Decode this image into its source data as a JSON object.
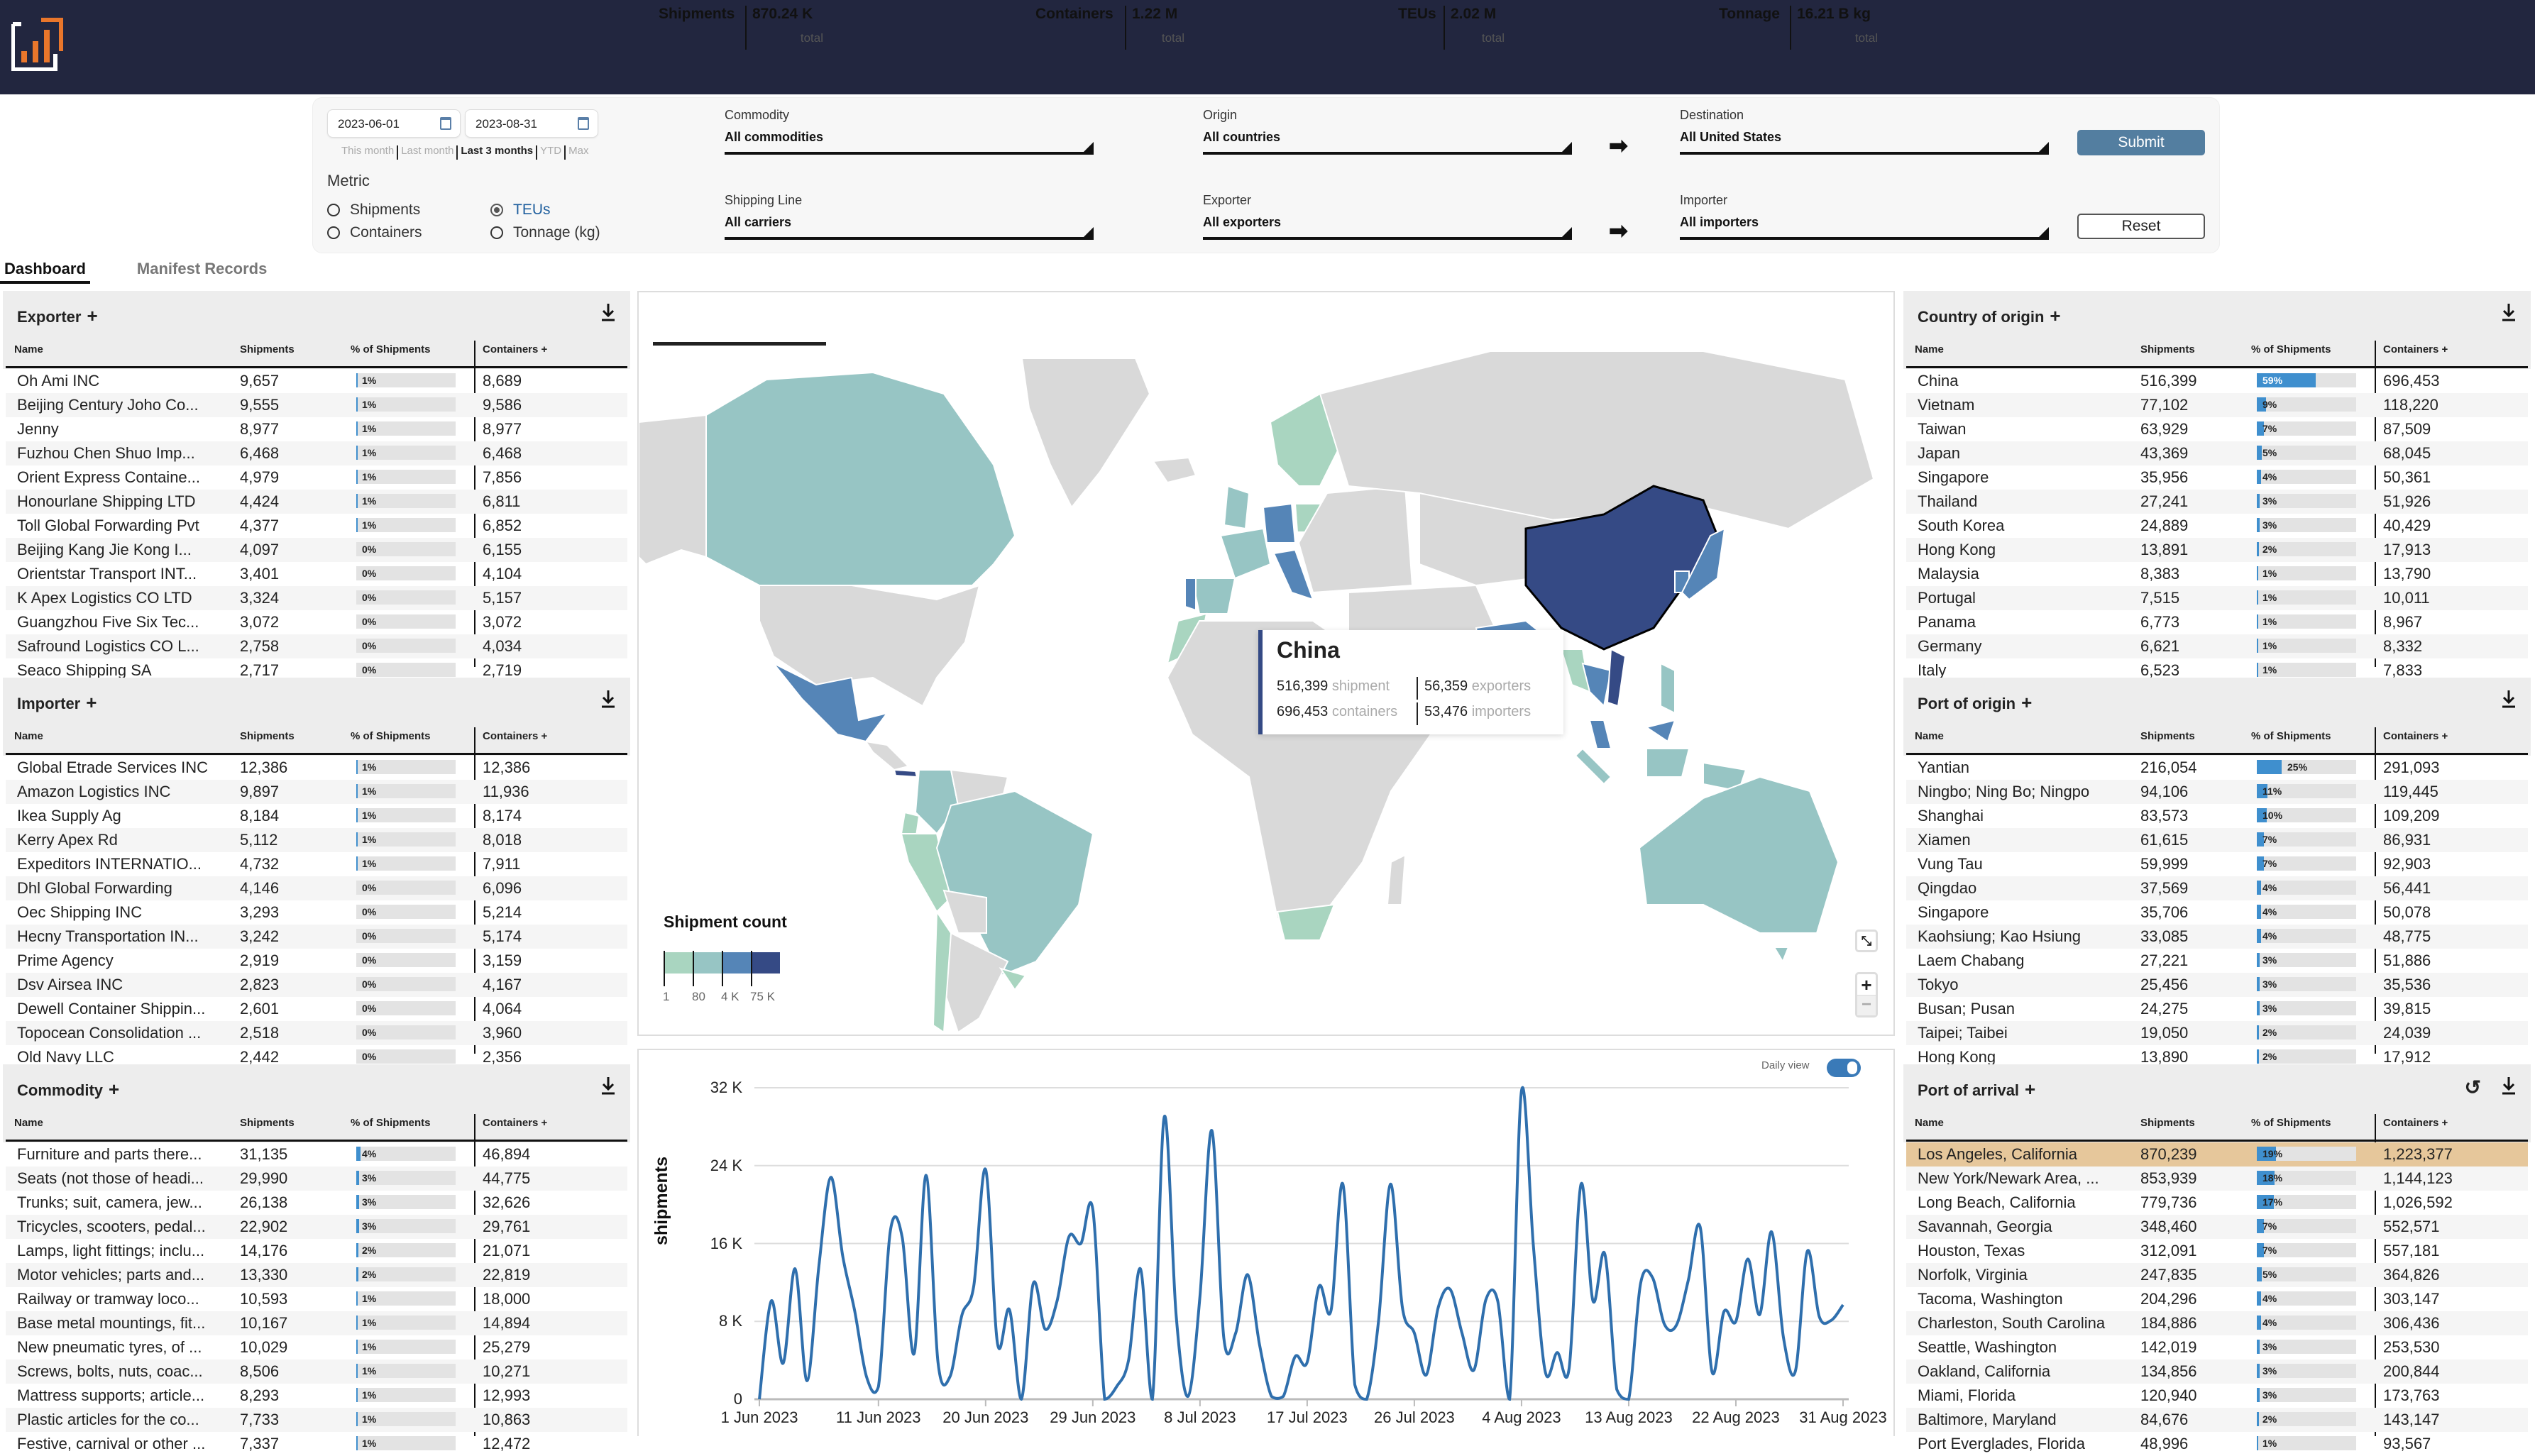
{
  "header": {
    "logo": "analytics-logo"
  },
  "filters": {
    "date_from": "2023-06-01",
    "date_to": "2023-08-31",
    "quick_ranges": [
      "This month",
      "Last month",
      "Last 3 months",
      "YTD",
      "Max"
    ],
    "quick_active": "Last 3 months",
    "metric_label": "Metric",
    "metrics": [
      {
        "label": "Shipments",
        "checked": false
      },
      {
        "label": "TEUs",
        "checked": true
      },
      {
        "label": "Containers",
        "checked": false
      },
      {
        "label": "Tonnage (kg)",
        "checked": false
      }
    ],
    "commodity": {
      "label": "Commodity",
      "value": "All commodities"
    },
    "origin": {
      "label": "Origin",
      "value": "All countries"
    },
    "destination": {
      "label": "Destination",
      "value": "All United States"
    },
    "shipping_line": {
      "label": "Shipping Line",
      "value": "All carriers"
    },
    "exporter": {
      "label": "Exporter",
      "value": "All exporters"
    },
    "importer": {
      "label": "Importer",
      "value": "All importers"
    },
    "arrow": "➡",
    "submit_label": "Submit",
    "reset_label": "Reset"
  },
  "tabs": [
    {
      "label": "Dashboard",
      "active": true
    },
    {
      "label": "Manifest Records",
      "active": false
    }
  ],
  "columns": {
    "name": "Name",
    "shipments": "Shipments",
    "pct": "% of Shipments",
    "containers": "Containers",
    "plus": "+"
  },
  "tables": {
    "exporter": {
      "title": "Exporter",
      "rows": [
        [
          "Oh Ami INC",
          "9,657",
          1,
          "8,689"
        ],
        [
          "Beijing Century Joho Co...",
          "9,555",
          1,
          "9,586"
        ],
        [
          "Jenny",
          "8,977",
          1,
          "8,977"
        ],
        [
          "Fuzhou Chen Shuo Imp...",
          "6,468",
          1,
          "6,468"
        ],
        [
          "Orient Express Containe...",
          "4,979",
          1,
          "7,856"
        ],
        [
          "Honourlane Shipping LTD",
          "4,424",
          1,
          "6,811"
        ],
        [
          "Toll Global Forwarding Pvt",
          "4,377",
          1,
          "6,852"
        ],
        [
          "Beijing Kang Jie Kong I...",
          "4,097",
          0,
          "6,155"
        ],
        [
          "Orientstar Transport INT...",
          "3,401",
          0,
          "4,104"
        ],
        [
          "K Apex Logistics CO LTD",
          "3,324",
          0,
          "5,157"
        ],
        [
          "Guangzhou Five Six Tec...",
          "3,072",
          0,
          "3,072"
        ],
        [
          "Safround Logistics CO L...",
          "2,758",
          0,
          "4,034"
        ],
        [
          "Seaco Shipping SA",
          "2,717",
          0,
          "2,719"
        ]
      ]
    },
    "importer": {
      "title": "Importer",
      "rows": [
        [
          "Global Etrade Services INC",
          "12,386",
          1,
          "12,386"
        ],
        [
          "Amazon Logistics INC",
          "9,897",
          1,
          "11,936"
        ],
        [
          "Ikea Supply Ag",
          "8,184",
          1,
          "8,174"
        ],
        [
          "Kerry Apex Rd",
          "5,112",
          1,
          "8,018"
        ],
        [
          "Expeditors INTERNATIO...",
          "4,732",
          1,
          "7,911"
        ],
        [
          "Dhl Global Forwarding",
          "4,146",
          0,
          "6,096"
        ],
        [
          "Oec Shipping INC",
          "3,293",
          0,
          "5,214"
        ],
        [
          "Hecny Transportation IN...",
          "3,242",
          0,
          "5,174"
        ],
        [
          "Prime Agency",
          "2,919",
          0,
          "3,159"
        ],
        [
          "Dsv Airsea INC",
          "2,823",
          0,
          "4,167"
        ],
        [
          "Dewell Container Shippin...",
          "2,601",
          0,
          "4,064"
        ],
        [
          "Topocean Consolidation ...",
          "2,518",
          0,
          "3,960"
        ],
        [
          "Old Navy LLC",
          "2,442",
          0,
          "2,356"
        ]
      ]
    },
    "commodity": {
      "title": "Commodity",
      "rows": [
        [
          "Furniture and parts there...",
          "31,135",
          4,
          "46,894"
        ],
        [
          "Seats (not those of headi...",
          "29,990",
          3,
          "44,775"
        ],
        [
          "Trunks; suit, camera, jew...",
          "26,138",
          3,
          "32,626"
        ],
        [
          "Tricycles, scooters, pedal...",
          "22,902",
          3,
          "29,761"
        ],
        [
          "Lamps, light fittings; inclu...",
          "14,176",
          2,
          "21,071"
        ],
        [
          "Motor vehicles; parts and...",
          "13,330",
          2,
          "22,819"
        ],
        [
          "Railway or tramway loco...",
          "10,593",
          1,
          "18,000"
        ],
        [
          "Base metal mountings, fit...",
          "10,167",
          1,
          "14,894"
        ],
        [
          "New pneumatic tyres, of ...",
          "10,029",
          1,
          "25,279"
        ],
        [
          "Screws, bolts, nuts, coac...",
          "8,506",
          1,
          "10,271"
        ],
        [
          "Mattress supports; article...",
          "8,293",
          1,
          "12,993"
        ],
        [
          "Plastic articles for the co...",
          "7,733",
          1,
          "10,863"
        ],
        [
          "Festive, carnival or other ...",
          "7,337",
          1,
          "12,472"
        ]
      ]
    },
    "country_of_origin": {
      "title": "Country of origin",
      "rows": [
        [
          "China",
          "516,399",
          59,
          "696,453"
        ],
        [
          "Vietnam",
          "77,102",
          9,
          "118,220"
        ],
        [
          "Taiwan",
          "63,929",
          7,
          "87,509"
        ],
        [
          "Japan",
          "43,369",
          5,
          "68,045"
        ],
        [
          "Singapore",
          "35,956",
          4,
          "50,361"
        ],
        [
          "Thailand",
          "27,241",
          3,
          "51,926"
        ],
        [
          "South Korea",
          "24,889",
          3,
          "40,429"
        ],
        [
          "Hong Kong",
          "13,891",
          2,
          "17,913"
        ],
        [
          "Malaysia",
          "8,383",
          1,
          "13,790"
        ],
        [
          "Portugal",
          "7,515",
          1,
          "10,011"
        ],
        [
          "Panama",
          "6,773",
          1,
          "8,967"
        ],
        [
          "Germany",
          "6,621",
          1,
          "8,332"
        ],
        [
          "Italy",
          "6,523",
          1,
          "7,833"
        ]
      ]
    },
    "port_of_origin": {
      "title": "Port of origin",
      "rows": [
        [
          "Yantian",
          "216,054",
          25,
          "291,093"
        ],
        [
          "Ningbo; Ning Bo; Ningpo",
          "94,106",
          11,
          "119,445"
        ],
        [
          "Shanghai",
          "83,573",
          10,
          "109,209"
        ],
        [
          "Xiamen",
          "61,615",
          7,
          "86,931"
        ],
        [
          "Vung Tau",
          "59,999",
          7,
          "92,903"
        ],
        [
          "Qingdao",
          "37,569",
          4,
          "56,441"
        ],
        [
          "Singapore",
          "35,706",
          4,
          "50,078"
        ],
        [
          "Kaohsiung; Kao Hsiung",
          "33,085",
          4,
          "48,775"
        ],
        [
          "Laem Chabang",
          "27,221",
          3,
          "51,886"
        ],
        [
          "Tokyo",
          "25,456",
          3,
          "35,536"
        ],
        [
          "Busan; Pusan",
          "24,275",
          3,
          "39,815"
        ],
        [
          "Taipei; Taibei",
          "19,050",
          2,
          "24,039"
        ],
        [
          "Hong Kong",
          "13,890",
          2,
          "17,912"
        ]
      ]
    },
    "port_of_arrival": {
      "title": "Port of arrival",
      "highlighted_row": 0,
      "rows": [
        [
          "Los Angeles, California",
          "870,239",
          19,
          "1,223,377"
        ],
        [
          "New York/Newark Area, ...",
          "853,939",
          18,
          "1,144,123"
        ],
        [
          "Long Beach, California",
          "779,736",
          17,
          "1,026,592"
        ],
        [
          "Savannah, Georgia",
          "348,460",
          7,
          "552,571"
        ],
        [
          "Houston, Texas",
          "312,091",
          7,
          "557,181"
        ],
        [
          "Norfolk, Virginia",
          "247,835",
          5,
          "364,826"
        ],
        [
          "Tacoma, Washington",
          "204,296",
          4,
          "303,147"
        ],
        [
          "Charleston, South Carolina",
          "184,886",
          4,
          "306,436"
        ],
        [
          "Seattle, Washington",
          "142,019",
          3,
          "253,530"
        ],
        [
          "Oakland, California",
          "134,856",
          3,
          "200,844"
        ],
        [
          "Miami, Florida",
          "120,940",
          3,
          "173,763"
        ],
        [
          "Baltimore, Maryland",
          "84,676",
          2,
          "143,147"
        ],
        [
          "Port Everglades, Florida",
          "48,996",
          1,
          "93,567"
        ]
      ]
    }
  },
  "map": {
    "stats": [
      {
        "label": "Shipments",
        "value": "870.24 K",
        "sub": "total",
        "active": true
      },
      {
        "label": "Containers",
        "value": "1.22 M",
        "sub": "total"
      },
      {
        "label": "TEUs",
        "value": "2.02 M",
        "sub": "total"
      },
      {
        "label": "Tonnage",
        "value": "16.21 B kg",
        "sub": "total"
      }
    ],
    "tooltip": {
      "country": "China",
      "shipments": "516,399",
      "shipments_unit": "shipment",
      "containers": "696,453",
      "containers_unit": "containers",
      "exporters": "56,359",
      "exporters_unit": "exporters",
      "importers": "53,476",
      "importers_unit": "importers"
    },
    "legend": {
      "title": "Shipment count",
      "ticks": [
        "1",
        "80",
        "4 K",
        "75 K"
      ],
      "colors": [
        "#a9d5c0",
        "#97c5c4",
        "#5585b7",
        "#354a85"
      ],
      "no_data_color": "#d9d9d9"
    },
    "country_buckets": {
      "China": 3,
      "Vietnam": 3,
      "Mexico": 2,
      "India": 2,
      "Japan": 2,
      "South Korea": 2,
      "Thailand": 2,
      "Malaysia": 2,
      "Germany": 2,
      "Italy": 2,
      "Portugal": 2,
      "Panama": 3,
      "Canada": 1,
      "Brazil": 1,
      "Colombia": 1,
      "Australia": 1,
      "France": 1,
      "Spain": 1,
      "United Kingdom": 1,
      "Indonesia": 1,
      "Philippines": 1,
      "Peru": 0,
      "Chile": 0,
      "Ecuador": 0,
      "Uruguay": 0,
      "Scandinavia": 0,
      "Poland": 0,
      "Morocco": 0,
      "South Africa": 0,
      "Myanmar": 0
    },
    "controls": {
      "fit": "fit-view-icon",
      "zoom_in": "+",
      "zoom_out": "−"
    }
  },
  "chart_data": {
    "type": "line",
    "title": "",
    "xlabel": "",
    "ylabel": "shipments",
    "ylim": [
      0,
      32000
    ],
    "yticks": [
      "0",
      "8 K",
      "16 K",
      "24 K",
      "32 K"
    ],
    "ytick_values": [
      0,
      8000,
      16000,
      24000,
      32000
    ],
    "grid": true,
    "toggle_label": "Daily view",
    "toggle_on": true,
    "x_start": "2023-06-01",
    "xtick_labels": [
      "1 Jun 2023",
      "11 Jun 2023",
      "20 Jun 2023",
      "29 Jun 2023",
      "8 Jul 2023",
      "17 Jul 2023",
      "26 Jul 2023",
      "4 Aug 2023",
      "13 Aug 2023",
      "22 Aug 2023",
      "31 Aug 2023"
    ],
    "xtick_day_index": [
      0,
      10,
      19,
      28,
      37,
      46,
      55,
      64,
      73,
      82,
      91
    ],
    "series": [
      {
        "name": "shipments",
        "color": "#2f6fad",
        "values": [
          0,
          10100,
          3700,
          13400,
          1900,
          13700,
          22800,
          14700,
          9100,
          2300,
          1300,
          17300,
          16600,
          4700,
          23000,
          3800,
          2300,
          8600,
          11600,
          23600,
          5700,
          9200,
          0,
          11900,
          7200,
          10100,
          16700,
          16000,
          19500,
          0,
          1300,
          4000,
          13400,
          0,
          29000,
          8600,
          300,
          10600,
          27600,
          6300,
          6800,
          12800,
          5600,
          300,
          300,
          4400,
          3800,
          11600,
          9100,
          22100,
          1500,
          0,
          8100,
          22100,
          9400,
          6800,
          2500,
          9400,
          11300,
          6800,
          3000,
          10200,
          10100,
          0,
          31700,
          15700,
          2800,
          4800,
          3200,
          22100,
          10100,
          14900,
          1000,
          0,
          11900,
          12500,
          7700,
          7600,
          12200,
          17700,
          2800,
          9000,
          8000,
          14400,
          8700,
          17200,
          6300,
          2900,
          15200,
          8500,
          8100,
          9700
        ]
      }
    ]
  }
}
